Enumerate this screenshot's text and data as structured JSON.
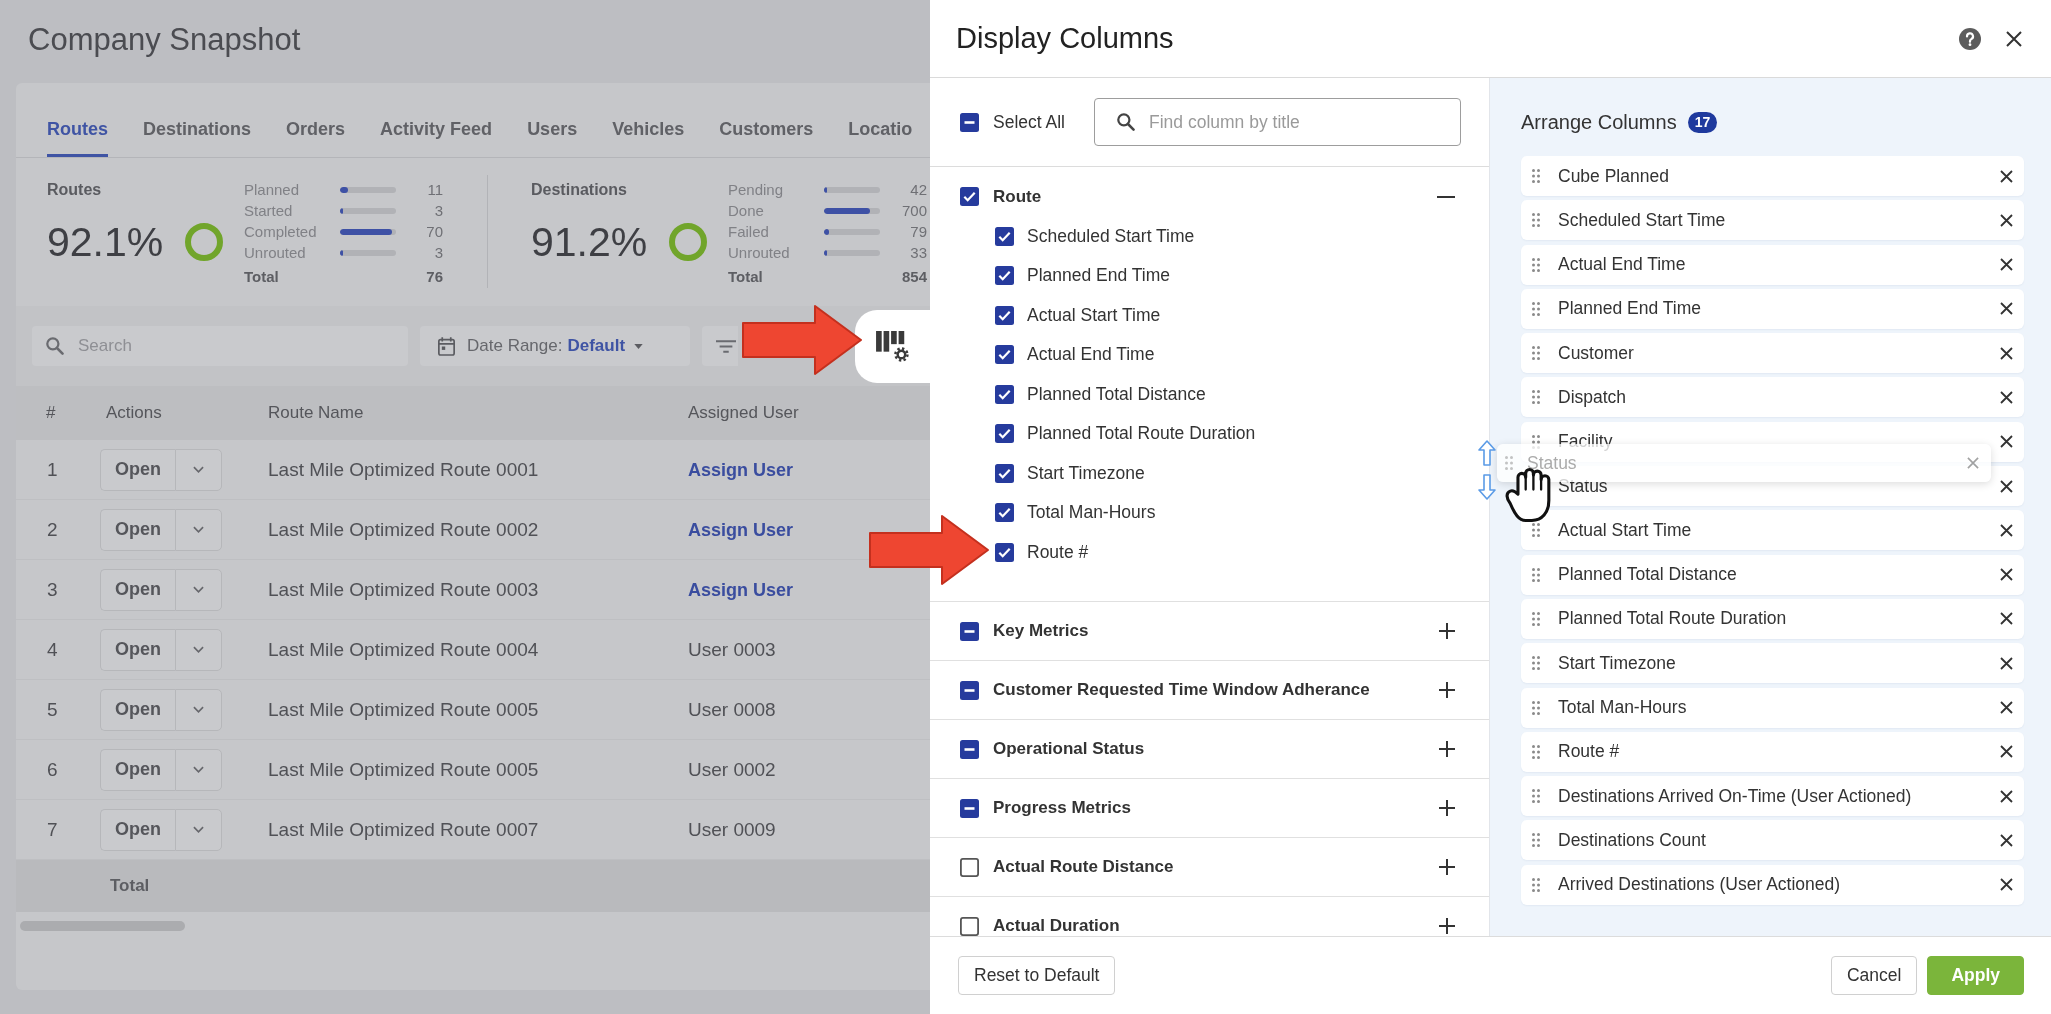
{
  "page": {
    "title": "Company Snapshot"
  },
  "tabs": [
    {
      "label": "Routes",
      "selected": true
    },
    {
      "label": "Destinations",
      "selected": false
    },
    {
      "label": "Orders",
      "selected": false
    },
    {
      "label": "Activity Feed",
      "selected": false
    },
    {
      "label": "Users",
      "selected": false
    },
    {
      "label": "Vehicles",
      "selected": false
    },
    {
      "label": "Customers",
      "selected": false
    },
    {
      "label": "Locatio",
      "selected": false
    }
  ],
  "summary": [
    {
      "title": "Routes",
      "percent": "92.1%",
      "stats": [
        {
          "label": "Planned",
          "value": "11",
          "level": 0.14
        },
        {
          "label": "Started",
          "value": "3",
          "level": 0.05
        },
        {
          "label": "Completed",
          "value": "70",
          "level": 0.92
        },
        {
          "label": "Unrouted",
          "value": "3",
          "level": 0.05
        }
      ],
      "total_label": "Total",
      "total": "76"
    },
    {
      "title": "Destinations",
      "percent": "91.2%",
      "stats": [
        {
          "label": "Pending",
          "value": "42",
          "level": 0.06
        },
        {
          "label": "Done",
          "value": "700",
          "level": 0.82
        },
        {
          "label": "Failed",
          "value": "79",
          "level": 0.09
        },
        {
          "label": "Unrouted",
          "value": "33",
          "level": 0.05
        }
      ],
      "total_label": "Total",
      "total": "854"
    }
  ],
  "toolbar": {
    "search": {
      "placeholder": "Search"
    },
    "date_range": {
      "label": "Date Range:",
      "value": "Default"
    }
  },
  "table": {
    "columns": [
      "#",
      "Actions",
      "Route Name",
      "Assigned User"
    ],
    "rows": [
      {
        "number": "1",
        "action": "Open",
        "route_name": "Last Mile Optimized Route 0001",
        "assigned_user": {
          "kind": "link",
          "text": "Assign User"
        }
      },
      {
        "number": "2",
        "action": "Open",
        "route_name": "Last Mile Optimized Route 0002",
        "assigned_user": {
          "kind": "link",
          "text": "Assign User"
        }
      },
      {
        "number": "3",
        "action": "Open",
        "route_name": "Last Mile Optimized Route 0003",
        "assigned_user": {
          "kind": "link",
          "text": "Assign User"
        }
      },
      {
        "number": "4",
        "action": "Open",
        "route_name": "Last Mile Optimized Route 0004",
        "assigned_user": {
          "kind": "text",
          "text": "User 0003"
        }
      },
      {
        "number": "5",
        "action": "Open",
        "route_name": "Last Mile Optimized Route 0005",
        "assigned_user": {
          "kind": "text",
          "text": "User 0008"
        }
      },
      {
        "number": "6",
        "action": "Open",
        "route_name": "Last Mile Optimized Route 0005",
        "assigned_user": {
          "kind": "text",
          "text": "User 0002"
        }
      },
      {
        "number": "7",
        "action": "Open",
        "route_name": "Last Mile Optimized Route 0007",
        "assigned_user": {
          "kind": "text",
          "text": "User 0009"
        }
      }
    ],
    "total_label": "Total"
  },
  "dialog": {
    "title": "Display Columns",
    "select_all": {
      "label": "Select All",
      "checked": false,
      "indeterminate": true
    },
    "search": {
      "placeholder": "Find column by title"
    },
    "groups": [
      {
        "label": "Route",
        "checked": true,
        "indeterminate": false,
        "expanded": true,
        "children": [
          {
            "label": "Scheduled Start Time",
            "checked": true
          },
          {
            "label": "Planned End Time",
            "checked": true
          },
          {
            "label": "Actual Start Time",
            "checked": true
          },
          {
            "label": "Actual End Time",
            "checked": true
          },
          {
            "label": "Planned Total Distance",
            "checked": true
          },
          {
            "label": "Planned Total Route Duration",
            "checked": true
          },
          {
            "label": "Start Timezone",
            "checked": true
          },
          {
            "label": "Total Man-Hours",
            "checked": true
          },
          {
            "label": "Route #",
            "checked": true
          }
        ]
      },
      {
        "label": "Key Metrics",
        "checked": false,
        "indeterminate": true,
        "expanded": false
      },
      {
        "label": "Customer Requested Time Window Adherance",
        "checked": false,
        "indeterminate": true,
        "expanded": false
      },
      {
        "label": "Operational Status",
        "checked": false,
        "indeterminate": true,
        "expanded": false
      },
      {
        "label": "Progress Metrics",
        "checked": false,
        "indeterminate": true,
        "expanded": false
      },
      {
        "label": "Actual Route Distance",
        "checked": false,
        "indeterminate": false,
        "expanded": false
      },
      {
        "label": "Actual Duration",
        "checked": false,
        "indeterminate": false,
        "expanded": false
      }
    ],
    "arrange": {
      "title": "Arrange Columns",
      "count": "17",
      "items": [
        {
          "label": "Cube Planned",
          "grabbed": false
        },
        {
          "label": "Scheduled Start Time",
          "grabbed": false
        },
        {
          "label": "Actual End Time",
          "grabbed": false
        },
        {
          "label": "Planned End Time",
          "grabbed": false
        },
        {
          "label": "Customer",
          "grabbed": false
        },
        {
          "label": "Dispatch",
          "grabbed": false
        },
        {
          "label": "Facility",
          "grabbed": false
        },
        {
          "label": "Status",
          "grabbed": true
        },
        {
          "label": "Actual Start Time",
          "grabbed": false
        },
        {
          "label": "Planned Total Distance",
          "grabbed": false
        },
        {
          "label": "Planned Total Route Duration",
          "grabbed": false
        },
        {
          "label": "Start Timezone",
          "grabbed": false
        },
        {
          "label": "Total Man-Hours",
          "grabbed": false
        },
        {
          "label": "Route #",
          "grabbed": false
        },
        {
          "label": "Destinations Arrived On-Time (User Actioned)",
          "grabbed": false
        },
        {
          "label": "Destinations Count",
          "grabbed": false
        },
        {
          "label": "Arrived Destinations (User Actioned)",
          "grabbed": false
        }
      ],
      "drag_preview": {
        "label": "Status"
      }
    },
    "buttons": {
      "reset": "Reset to Default",
      "cancel": "Cancel",
      "apply": "Apply"
    }
  }
}
